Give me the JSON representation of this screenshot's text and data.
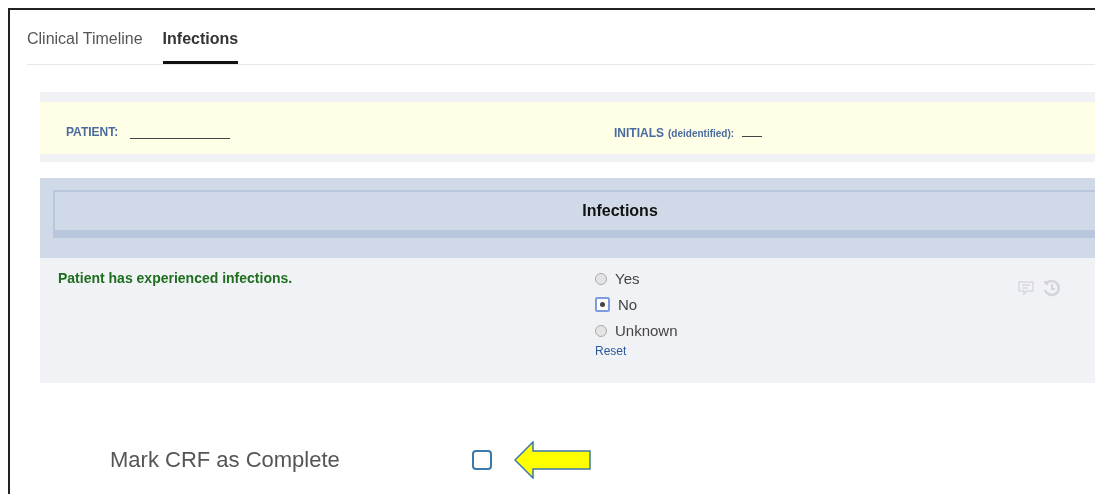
{
  "tabs": [
    {
      "label": "Clinical Timeline",
      "selected": false
    },
    {
      "label": "Infections",
      "selected": true
    }
  ],
  "patient": {
    "label": "PATIENT:",
    "initials_label": "INITIALS",
    "initials_note": "(deidentified):"
  },
  "section": {
    "title": "Infections"
  },
  "question": {
    "label": "Patient has experienced infections.",
    "options": [
      {
        "label": "Yes",
        "selected": false
      },
      {
        "label": "No",
        "selected": true
      },
      {
        "label": "Unknown",
        "selected": false
      }
    ],
    "reset": "Reset"
  },
  "complete": {
    "label": "Mark CRF as Complete",
    "checked": false
  }
}
